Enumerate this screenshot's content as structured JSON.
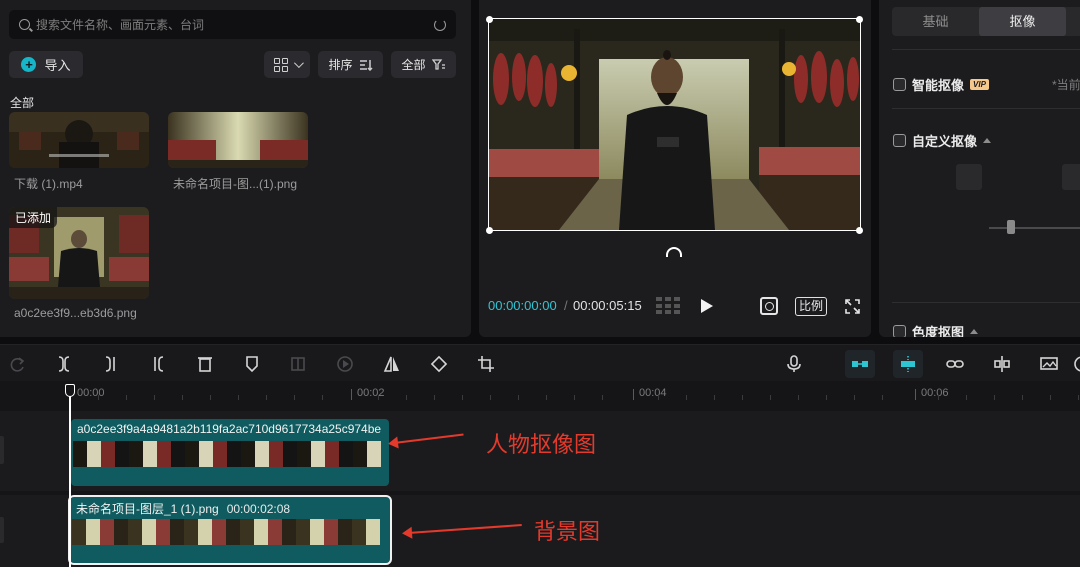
{
  "media": {
    "search_placeholder": "搜索文件名称、画面元素、台词",
    "import_label": "导入",
    "sort_label": "排序",
    "filter_label": "全部",
    "section_label": "全部",
    "items": [
      {
        "caption": "下载 (1).mp4"
      },
      {
        "caption": "未命名项目-图...(1).png"
      },
      {
        "caption": "a0c2ee3f9...eb3d6.png",
        "badge": "已添加"
      }
    ]
  },
  "preview": {
    "current_time": "00:00:00:00",
    "separator": "/",
    "total_time": "00:00:05:15",
    "ratio_label": "比例"
  },
  "properties": {
    "tabs": [
      {
        "label": "基础",
        "active": false
      },
      {
        "label": "抠像",
        "active": true
      }
    ],
    "smart_cutout_label": "智能抠像",
    "vip_label": "VIP",
    "current_hint": "*当前",
    "custom_cutout_label": "自定义抠像",
    "chroma_key_label": "色度抠图"
  },
  "timeline": {
    "ticks": [
      {
        "label": "00:00"
      },
      {
        "label": "00:02"
      },
      {
        "label": "00:04"
      },
      {
        "label": "00:06"
      }
    ],
    "clips": [
      {
        "title": "a0c2ee3f9a4a9481a2b119fa2ac710d9617734a25c974be",
        "duration": ""
      },
      {
        "title": "未命名项目-图层_1 (1).png",
        "duration": "00:00:02:08"
      }
    ]
  },
  "annotations": {
    "person_label": "人物抠像图",
    "background_label": "背景图"
  },
  "colors": {
    "accent": "#2ec5d3",
    "clip_fill": "#0f5b5f",
    "annotation": "#e33a2c"
  }
}
